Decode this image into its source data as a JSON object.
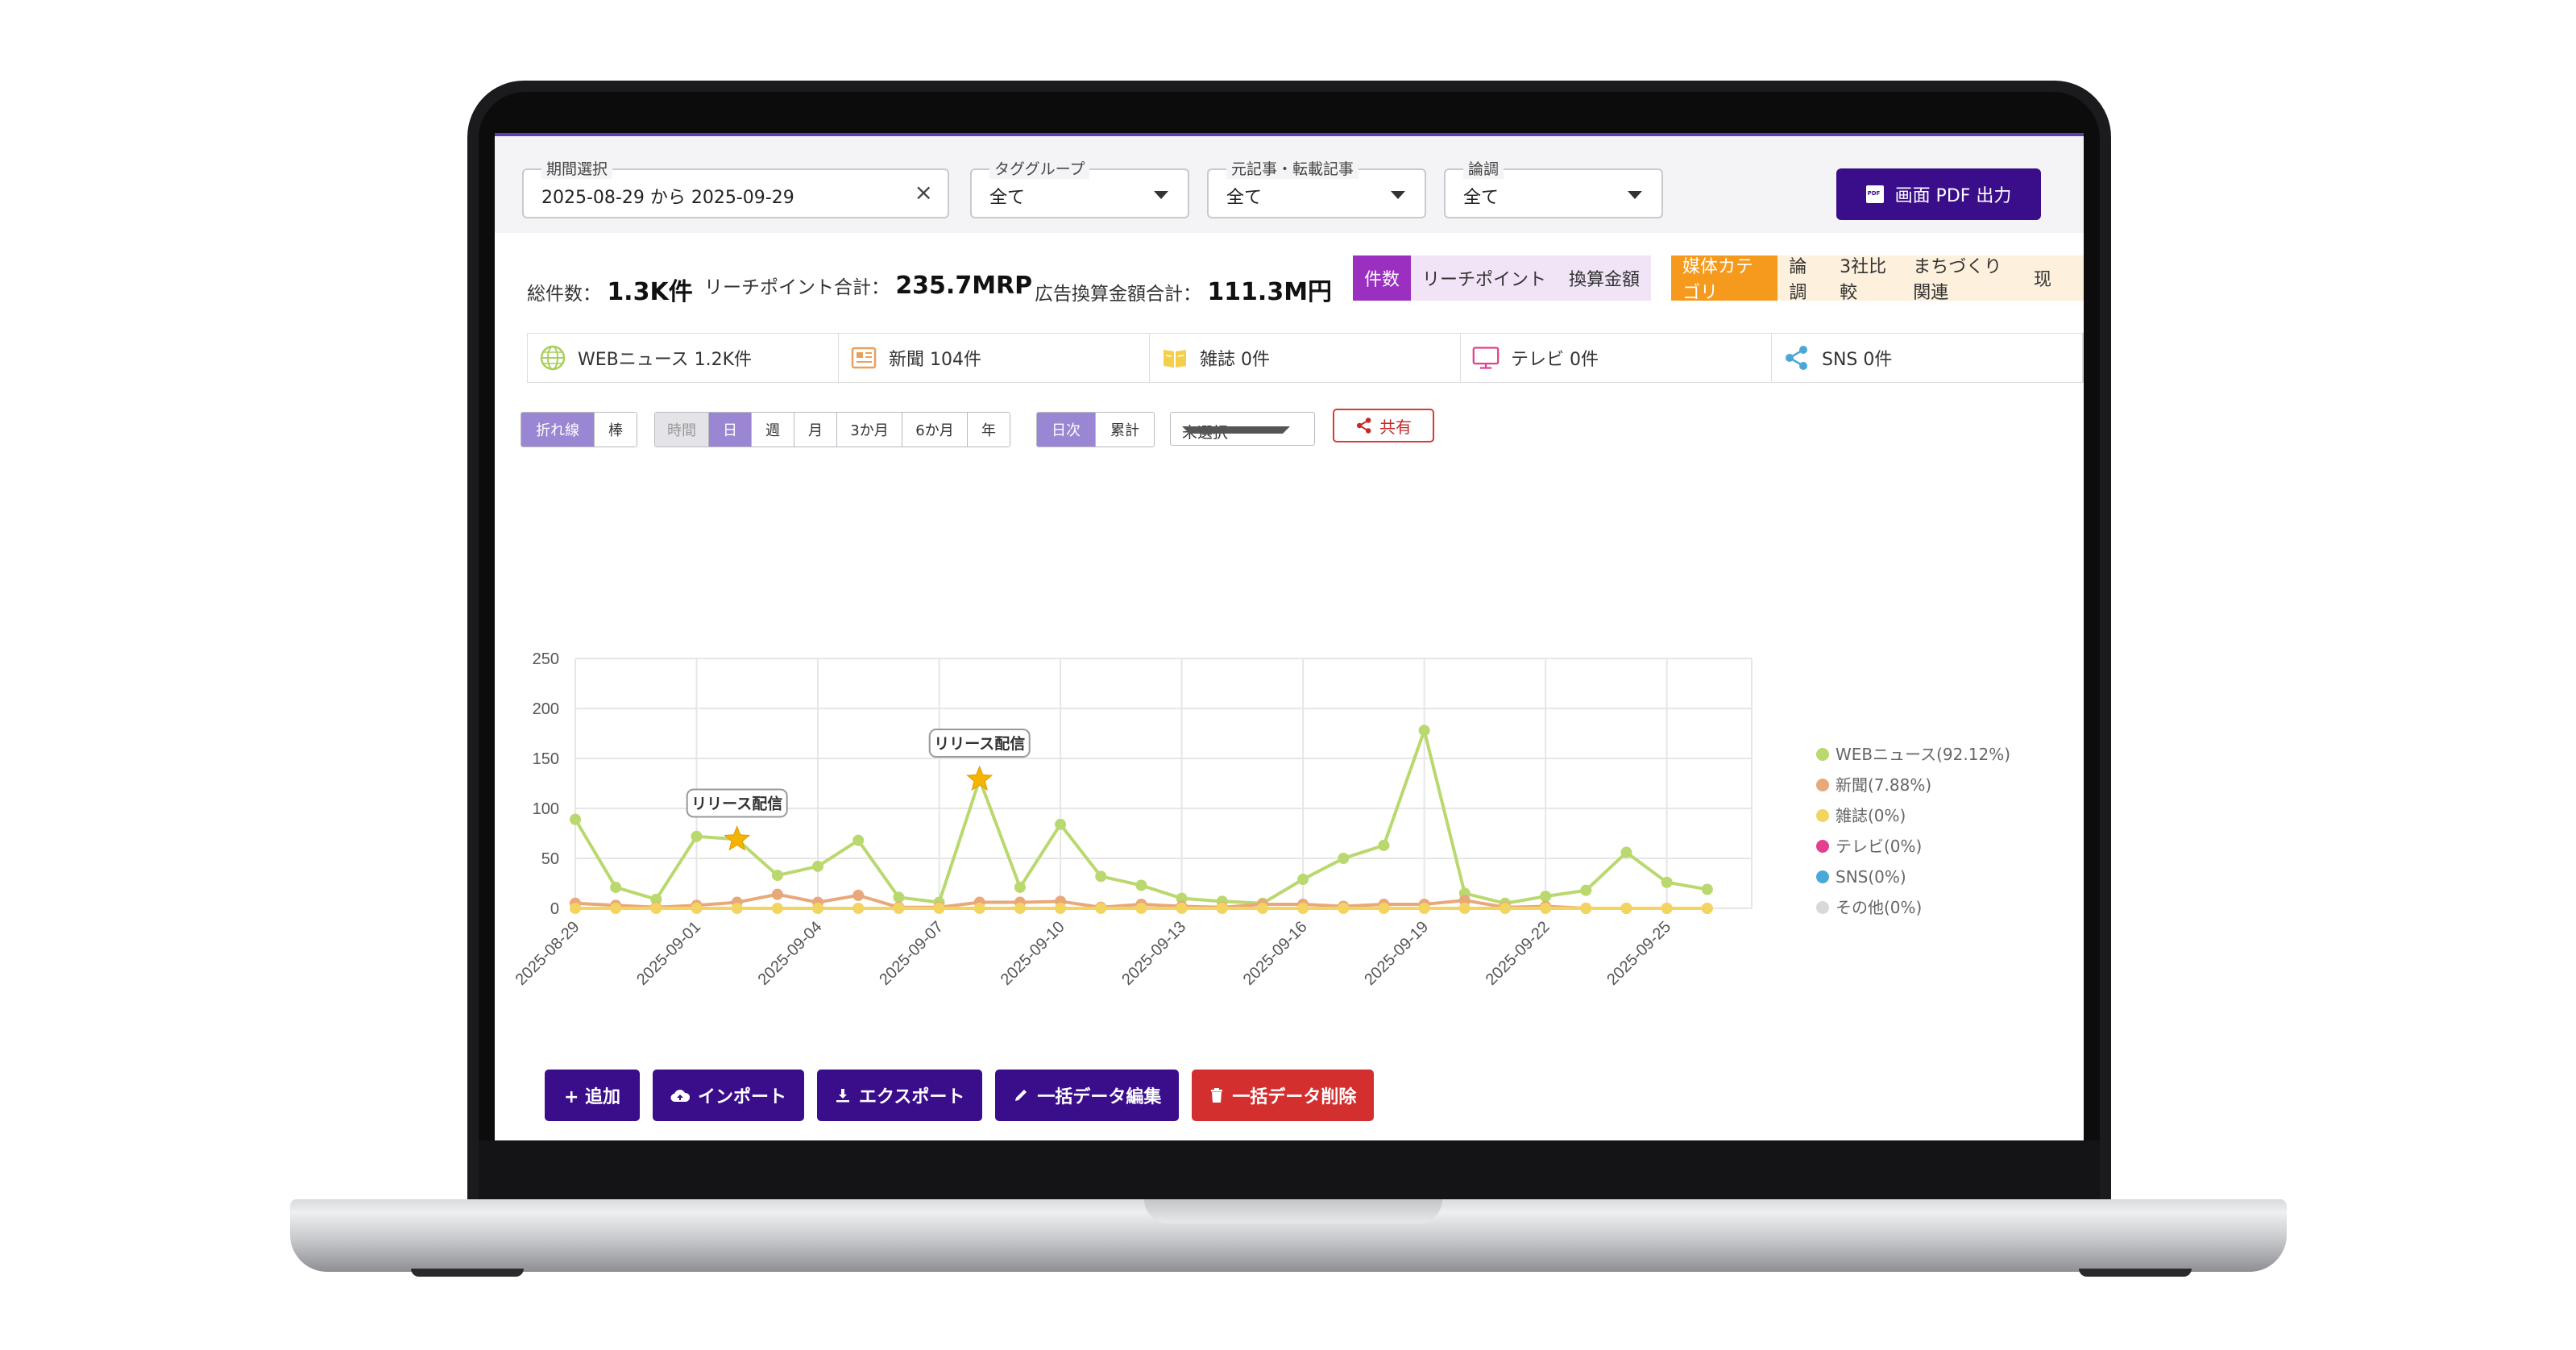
{
  "filters": {
    "period": {
      "label": "期間選択",
      "value": "2025-08-29 から 2025-09-29"
    },
    "tag_group": {
      "label": "タググループ",
      "value": "全て"
    },
    "article_type": {
      "label": "元記事・転載記事",
      "value": "全て"
    },
    "tone": {
      "label": "論調",
      "value": "全て"
    },
    "pdf_button": "画面 PDF 出力"
  },
  "summary": {
    "total_label": "総件数：",
    "total_value": "1.3K件",
    "reach_label": "リーチポイント合計：",
    "reach_value": "235.7MRP",
    "ad_label": "広告換算金額合計：",
    "ad_value": "111.3M円",
    "metric_tabs": [
      "件数",
      "リーチポイント",
      "換算金額"
    ],
    "category_tabs": [
      "媒体カテゴリ",
      "論調",
      "3社比較",
      "まちづくり関連",
      "现"
    ]
  },
  "media": [
    {
      "icon": "globe-icon",
      "label": "WEBニュース 1.2K件",
      "color": "#a8cf5a"
    },
    {
      "icon": "newspaper-icon",
      "label": "新聞 104件",
      "color": "#e9a05f"
    },
    {
      "icon": "magazine-icon",
      "label": "雑誌 0件",
      "color": "#f4cf4a"
    },
    {
      "icon": "tv-icon",
      "label": "テレビ 0件",
      "color": "#e2408f"
    },
    {
      "icon": "share-icon",
      "label": "SNS 0件",
      "color": "#4aa8d8"
    }
  ],
  "controls": {
    "chart_type": [
      "折れ線",
      "棒"
    ],
    "granularity": [
      "時間",
      "日",
      "週",
      "月",
      "3か月",
      "6か月",
      "年"
    ],
    "mode": [
      "日次",
      "累計"
    ],
    "select": "未選択",
    "share": "共有"
  },
  "chart_data": {
    "type": "line",
    "ylim": [
      0,
      250
    ],
    "yticks": [
      0,
      50,
      100,
      150,
      200,
      250
    ],
    "x": [
      "2025-08-29",
      "2025-08-30",
      "2025-08-31",
      "2025-09-01",
      "2025-09-02",
      "2025-09-03",
      "2025-09-04",
      "2025-09-05",
      "2025-09-06",
      "2025-09-07",
      "2025-09-08",
      "2025-09-09",
      "2025-09-10",
      "2025-09-11",
      "2025-09-12",
      "2025-09-13",
      "2025-09-14",
      "2025-09-15",
      "2025-09-16",
      "2025-09-17",
      "2025-09-18",
      "2025-09-19",
      "2025-09-20",
      "2025-09-21",
      "2025-09-22",
      "2025-09-23",
      "2025-09-24",
      "2025-09-25",
      "2025-09-26",
      "2025-09-27"
    ],
    "xticks": [
      "2025-08-29",
      "2025-09-01",
      "2025-09-04",
      "2025-09-07",
      "2025-09-10",
      "2025-09-13",
      "2025-09-16",
      "2025-09-19",
      "2025-09-22",
      "2025-09-25"
    ],
    "series": [
      {
        "name": "WEBニュース(92.12%)",
        "color": "#b9d86e",
        "values": [
          89,
          21,
          9,
          72,
          69,
          33,
          42,
          68,
          11,
          6,
          129,
          21,
          84,
          32,
          23,
          10,
          7,
          5,
          29,
          50,
          63,
          178,
          15,
          5,
          12,
          18,
          56,
          26,
          19,
          null
        ]
      },
      {
        "name": "新聞(7.88%)",
        "color": "#e9a87a",
        "values": [
          5,
          3,
          1,
          3,
          6,
          14,
          6,
          13,
          1,
          1,
          6,
          6,
          7,
          1,
          4,
          2,
          1,
          4,
          4,
          2,
          4,
          4,
          8,
          1,
          2,
          0,
          0,
          0,
          0,
          null
        ]
      },
      {
        "name": "雑誌(0%)",
        "color": "#f3d460",
        "values": [
          0,
          0,
          0,
          0,
          0,
          0,
          0,
          0,
          0,
          0,
          0,
          0,
          0,
          0,
          0,
          0,
          0,
          0,
          0,
          0,
          0,
          0,
          0,
          0,
          0,
          0,
          0,
          0,
          0,
          null
        ]
      },
      {
        "name": "テレビ(0%)",
        "color": "#e2408f",
        "values": []
      },
      {
        "name": "SNS(0%)",
        "color": "#4aa8d8",
        "values": []
      },
      {
        "name": "その他(0%)",
        "color": "#d8d8d8",
        "values": []
      }
    ],
    "annotations": [
      {
        "x": "2025-09-02",
        "y": 69,
        "label": "リリース配信"
      },
      {
        "x": "2025-09-08",
        "y": 129,
        "label": "リリース配信"
      }
    ]
  },
  "actions": [
    "+ 追加",
    "インポート",
    "エクスポート",
    "一括データ編集",
    "一括データ削除"
  ]
}
